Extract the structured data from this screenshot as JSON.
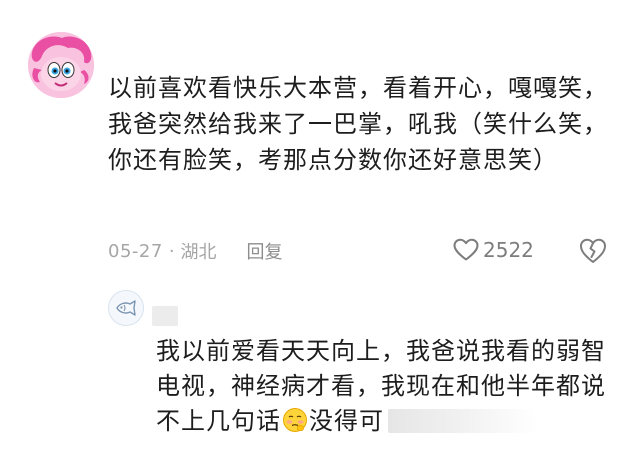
{
  "comment": {
    "avatar_icon": "pink-pony-avatar-icon",
    "text": "以前喜欢看快乐大本营，看着开心，嘎嘎笑，我爸突然给我来了一巴掌，吼我（笑什么笑，你还有脸笑，考那点分数你还好意思笑）",
    "date": "05-27",
    "separator": "·",
    "location": "湖北",
    "reply_label": "回复",
    "like_icon": "heart-outline-icon",
    "like_count": "2522",
    "dislike_icon": "broken-heart-icon"
  },
  "reply": {
    "avatar_icon": "fish-avatar-icon",
    "text_before_emoji": "我以前爱看天天向上，我爸说我看的弱智电视，神经病才看，我现在和他半年都说不上几句话",
    "emoji_icon": "embarrassed-face-emoji-icon",
    "text_after_emoji": "没得可"
  },
  "colors": {
    "text": "#1d1d1d",
    "meta": "#a6a6a6",
    "icon": "#7d7d7d",
    "avatar_pink": "#f7b8d9"
  }
}
